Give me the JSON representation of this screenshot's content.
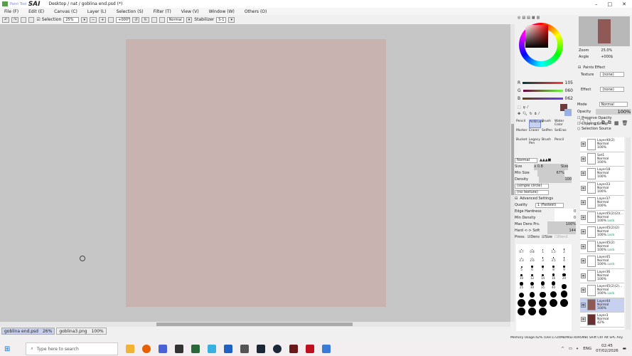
{
  "app": {
    "brand": "Paint Tool",
    "name": "SAI",
    "title": "Desktop / nat / goblina end.psd (*)"
  },
  "menu": [
    "File (F)",
    "Edit (E)",
    "Canvas (C)",
    "Layer (L)",
    "Selection (S)",
    "Filter (T)",
    "View (V)",
    "Window (W)",
    "Others (O)"
  ],
  "toolbar": {
    "selection_label": "Selection",
    "zoom": "25%",
    "angle": "+000°",
    "blend": "Normal",
    "stabilizer_label": "Stabilizer",
    "stabilizer": "S-1"
  },
  "canvas": {
    "placeholder": ""
  },
  "tabs": [
    {
      "name": "goblina end.psd",
      "zoom": "26%",
      "active": true
    },
    {
      "name": "goblina3.png",
      "zoom": "100%",
      "active": false
    }
  ],
  "status": "Memory Usage:42% (Use:1724MB/Max:4095MB)  Shift Ctrl Alt SPC Any",
  "color": {
    "R": "105",
    "G": "060",
    "B": "062",
    "main": "#693c3e",
    "secondary": "#9ab0e0"
  },
  "navigator": {
    "zoom_label": "Zoom",
    "zoom": "25.0%",
    "angle_label": "Angle",
    "angle": "+000$"
  },
  "paper": {
    "title": "Paints Effect",
    "texture_label": "Texture",
    "texture": "(none)",
    "effect_label": "Effect",
    "effect": "(none)",
    "mode_label": "Mode",
    "mode": "Normal",
    "opacity_label": "Opacity",
    "opacity": "100%",
    "preserve": "Preserve Opacity",
    "clipping": "Clipping Group",
    "selsource": "Selection Source"
  },
  "tools": [
    "Pencil",
    "AirBrush",
    "Brush",
    "Water Color",
    "Marker",
    "Eraser",
    "SelPen",
    "SelEras",
    "Bucket",
    "Legacy Pen",
    "Brush",
    "Pencil"
  ],
  "brush": {
    "blend": "Normal",
    "size_label": "Size",
    "size_mult": "x 0.8",
    "size": "Size",
    "minsize_label": "Min Size",
    "minsize": "67%",
    "density_label": "Density",
    "density": "100",
    "shape": "(simple circle)",
    "texture": "(no texture)",
    "adv": "Advanced Settings",
    "quality_label": "Quality",
    "quality": "1 (Fastest)",
    "edge_label": "Edge Hardness",
    "edge": "0",
    "mindens_label": "Min Density",
    "mindens": "0",
    "maxdens_label": "Max Dens Prs.",
    "maxdens": "100%",
    "hardsoft_label": "Hard <-> Soft",
    "hardsoft": "144",
    "press_label": "Press:",
    "dens": "Dens",
    "blend_opt": "Blend"
  },
  "brush_sizes": [
    "0.7",
    "0.8",
    "1",
    "1.5",
    "2",
    "2.3",
    "2.6",
    "3",
    "3.5",
    "4",
    "5",
    "6",
    "7",
    "8",
    "9",
    "10",
    "12",
    "14",
    "16",
    "20",
    "25",
    "30",
    "35",
    "40",
    "50",
    "60",
    "70",
    "80",
    "100",
    "120",
    "160",
    "200",
    "250",
    "300",
    "350",
    "400",
    "450",
    "500"
  ],
  "layers": [
    {
      "name": "Layer40(2)",
      "mode": "Normal",
      "opacity": "100%",
      "lock": ""
    },
    {
      "name": "Set1",
      "mode": "Normal",
      "opacity": "100%",
      "lock": ""
    },
    {
      "name": "Layer18",
      "mode": "Normal",
      "opacity": "100%",
      "lock": ""
    },
    {
      "name": "Layer23",
      "mode": "Normal",
      "opacity": "100%",
      "lock": ""
    },
    {
      "name": "Layer37",
      "mode": "Normal",
      "opacity": "100%",
      "lock": ""
    },
    {
      "name": "Layer45(2)(2)(...",
      "mode": "Normal",
      "opacity": "100%",
      "lock": "Lock"
    },
    {
      "name": "Layer45(2)(2)",
      "mode": "Normal",
      "opacity": "100%",
      "lock": "Lock"
    },
    {
      "name": "Layer45(2)",
      "mode": "Normal",
      "opacity": "100%",
      "lock": "Lock"
    },
    {
      "name": "Layer45",
      "mode": "Normal",
      "opacity": "100%",
      "lock": "Lock"
    },
    {
      "name": "Layer36",
      "mode": "Normal",
      "opacity": "100%",
      "lock": ""
    },
    {
      "name": "Layer45(2)(2)...",
      "mode": "Normal",
      "opacity": "100%",
      "lock": "Lock"
    },
    {
      "name": "Layer44",
      "mode": "Normal",
      "opacity": "100%",
      "lock": "",
      "selected": true
    },
    {
      "name": "Layer3",
      "mode": "Normal",
      "opacity": "42%",
      "lock": ""
    }
  ],
  "taskbar": {
    "search_placeholder": "Type here to search",
    "lang": "ENG",
    "time": "02:45",
    "date": "07/02/2026"
  }
}
